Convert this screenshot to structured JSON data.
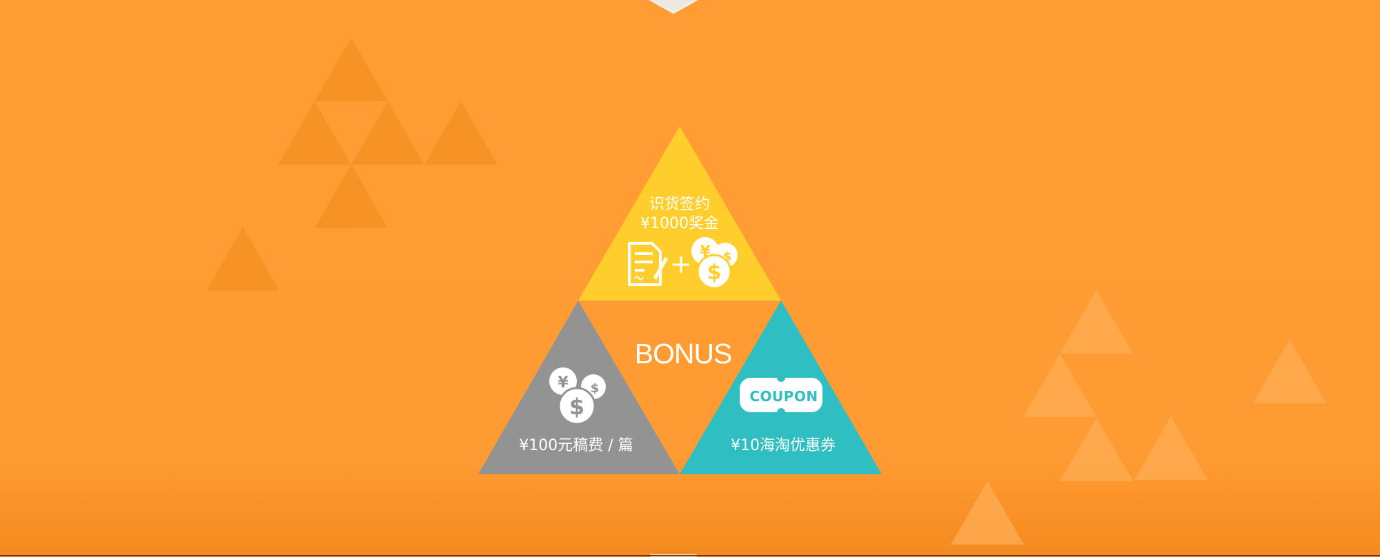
{
  "pyramid": {
    "top": {
      "line1": "识货签约",
      "line2": "¥1000奖金",
      "color": "#ffce2c",
      "icons": [
        "contract-icon",
        "plus-icon",
        "coins-icon"
      ]
    },
    "center": {
      "label": "BONUS"
    },
    "left": {
      "label": "¥100元稿费 / 篇",
      "color": "#939393",
      "icons": [
        "coins-icon"
      ]
    },
    "right": {
      "label": "¥10海淘优惠券",
      "color": "#2fbfc2",
      "icons": [
        "coupon-icon"
      ],
      "coupon_text": "COUPON"
    }
  },
  "colors": {
    "background": "#ff9c33",
    "center_triangle": "#ff9d33"
  }
}
